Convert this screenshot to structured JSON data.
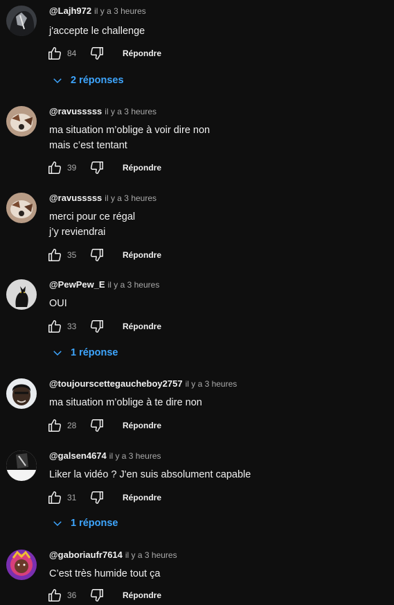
{
  "comments": [
    {
      "author": "@Lajh972",
      "time": "il y a 3 heures",
      "text": "j'accepte le challenge",
      "likes": "84",
      "reply_label": "Répondre",
      "replies_label": "2 réponses"
    },
    {
      "author": "@ravusssss",
      "time": "il y a 3 heures",
      "text": "ma situation m’oblige à voir dire non\nmais c’est tentant",
      "likes": "39",
      "reply_label": "Répondre"
    },
    {
      "author": "@ravusssss",
      "time": "il y a 3 heures",
      "text": "merci pour ce régal\nj’y reviendrai",
      "likes": "35",
      "reply_label": "Répondre"
    },
    {
      "author": "@PewPew_E",
      "time": "il y a 3 heures",
      "text": "OUI",
      "likes": "33",
      "reply_label": "Répondre",
      "replies_label": "1 réponse"
    },
    {
      "author": "@toujourscettegaucheboy2757",
      "time": "il y a 3 heures",
      "text": "ma situation m’oblige à te dire non",
      "likes": "28",
      "reply_label": "Répondre"
    },
    {
      "author": "@galsen4674",
      "time": "il y a 3 heures",
      "text": "Liker la vidéo ? J'en suis absolument capable",
      "likes": "31",
      "reply_label": "Répondre",
      "replies_label": "1 réponse"
    },
    {
      "author": "@gaboriaufr7614",
      "time": "il y a 3 heures",
      "text": "C’est très humide tout ça",
      "likes": "36",
      "reply_label": "Répondre"
    }
  ],
  "icons": {
    "like": "thumb-up-icon",
    "dislike": "thumb-down-icon",
    "expand": "chevron-down-icon"
  },
  "colors": {
    "background": "#0f0f0f",
    "text": "#f1f1f1",
    "secondary": "#aaaaaa",
    "link": "#3ea6ff"
  }
}
